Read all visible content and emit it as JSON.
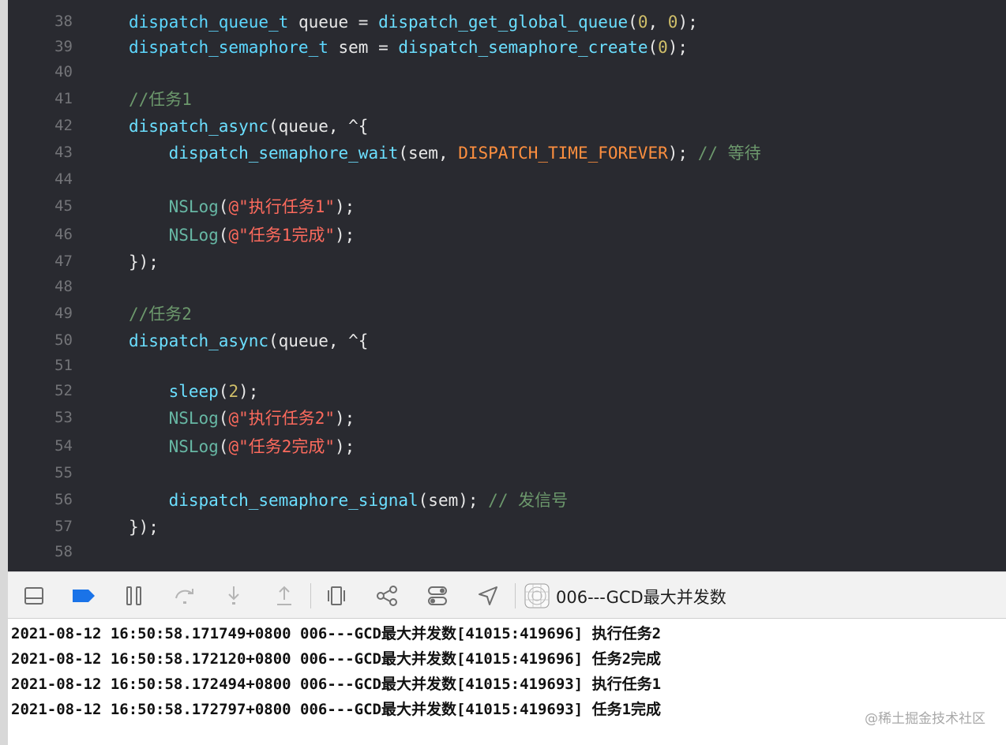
{
  "editor": {
    "lines": [
      {
        "n": "38",
        "tokens": [
          [
            "tok-type",
            "dispatch_queue_t"
          ],
          [
            "tok-plain",
            " queue = "
          ],
          [
            "tok-fn",
            "dispatch_get_global_queue"
          ],
          [
            "tok-plain",
            "("
          ],
          [
            "tok-num",
            "0"
          ],
          [
            "tok-plain",
            ", "
          ],
          [
            "tok-num",
            "0"
          ],
          [
            "tok-plain",
            ");"
          ]
        ]
      },
      {
        "n": "39",
        "tokens": [
          [
            "tok-type",
            "dispatch_semaphore_t"
          ],
          [
            "tok-plain",
            " sem = "
          ],
          [
            "tok-fn",
            "dispatch_semaphore_create"
          ],
          [
            "tok-plain",
            "("
          ],
          [
            "tok-num",
            "0"
          ],
          [
            "tok-plain",
            ");"
          ]
        ]
      },
      {
        "n": "40",
        "tokens": []
      },
      {
        "n": "41",
        "tokens": [
          [
            "tok-com",
            "//任务1"
          ]
        ]
      },
      {
        "n": "42",
        "tokens": [
          [
            "tok-fn",
            "dispatch_async"
          ],
          [
            "tok-plain",
            "(queue, ^{"
          ]
        ]
      },
      {
        "n": "43",
        "tokens": [
          [
            "tok-plain",
            "    "
          ],
          [
            "tok-fn",
            "dispatch_semaphore_wait"
          ],
          [
            "tok-plain",
            "(sem, "
          ],
          [
            "tok-macro",
            "DISPATCH_TIME_FOREVER"
          ],
          [
            "tok-plain",
            "); "
          ],
          [
            "tok-com",
            "// 等待"
          ]
        ]
      },
      {
        "n": "44",
        "tokens": []
      },
      {
        "n": "45",
        "tokens": [
          [
            "tok-plain",
            "    "
          ],
          [
            "tok-nslog",
            "NSLog"
          ],
          [
            "tok-plain",
            "("
          ],
          [
            "tok-str",
            "@\"执行任务1\""
          ],
          [
            "tok-plain",
            ");"
          ]
        ]
      },
      {
        "n": "46",
        "tokens": [
          [
            "tok-plain",
            "    "
          ],
          [
            "tok-nslog",
            "NSLog"
          ],
          [
            "tok-plain",
            "("
          ],
          [
            "tok-str",
            "@\"任务1完成\""
          ],
          [
            "tok-plain",
            ");"
          ]
        ]
      },
      {
        "n": "47",
        "tokens": [
          [
            "tok-plain",
            "});"
          ]
        ]
      },
      {
        "n": "48",
        "tokens": []
      },
      {
        "n": "49",
        "tokens": [
          [
            "tok-com",
            "//任务2"
          ]
        ]
      },
      {
        "n": "50",
        "tokens": [
          [
            "tok-fn",
            "dispatch_async"
          ],
          [
            "tok-plain",
            "(queue, ^{"
          ]
        ]
      },
      {
        "n": "51",
        "tokens": []
      },
      {
        "n": "52",
        "tokens": [
          [
            "tok-plain",
            "    "
          ],
          [
            "tok-fn",
            "sleep"
          ],
          [
            "tok-plain",
            "("
          ],
          [
            "tok-num",
            "2"
          ],
          [
            "tok-plain",
            ");"
          ]
        ]
      },
      {
        "n": "53",
        "tokens": [
          [
            "tok-plain",
            "    "
          ],
          [
            "tok-nslog",
            "NSLog"
          ],
          [
            "tok-plain",
            "("
          ],
          [
            "tok-str",
            "@\"执行任务2\""
          ],
          [
            "tok-plain",
            ");"
          ]
        ]
      },
      {
        "n": "54",
        "tokens": [
          [
            "tok-plain",
            "    "
          ],
          [
            "tok-nslog",
            "NSLog"
          ],
          [
            "tok-plain",
            "("
          ],
          [
            "tok-str",
            "@\"任务2完成\""
          ],
          [
            "tok-plain",
            ");"
          ]
        ]
      },
      {
        "n": "55",
        "tokens": []
      },
      {
        "n": "56",
        "tokens": [
          [
            "tok-plain",
            "    "
          ],
          [
            "tok-fn",
            "dispatch_semaphore_signal"
          ],
          [
            "tok-plain",
            "(sem); "
          ],
          [
            "tok-com",
            "// 发信号"
          ]
        ]
      },
      {
        "n": "57",
        "tokens": [
          [
            "tok-plain",
            "});"
          ]
        ]
      },
      {
        "n": "58",
        "tokens": []
      }
    ]
  },
  "debug_bar": {
    "buttons": [
      {
        "name": "hide-debug-area-button",
        "icon": "panel-icon"
      },
      {
        "name": "breakpoints-toggle-button",
        "icon": "breakpoint-icon"
      },
      {
        "name": "pause-button",
        "icon": "pause-icon"
      },
      {
        "name": "step-over-button",
        "icon": "step-over-icon"
      },
      {
        "name": "step-into-button",
        "icon": "step-into-icon"
      },
      {
        "name": "step-out-button",
        "icon": "step-out-icon"
      },
      {
        "name": "debug-view-hierarchy-button",
        "icon": "view-hierarchy-icon"
      },
      {
        "name": "memory-graph-button",
        "icon": "memory-graph-icon"
      },
      {
        "name": "environment-overrides-button",
        "icon": "toggles-icon"
      },
      {
        "name": "simulate-location-button",
        "icon": "location-arrow-icon"
      }
    ],
    "target_name": "006---GCD最大并发数",
    "colors": {
      "breakpoint_accent": "#1a73e8",
      "icon_gray": "#6e6e6e",
      "icon_disabled": "#b5b5b5"
    }
  },
  "console": {
    "lines": [
      "2021-08-12 16:50:58.171749+0800 006---GCD最大并发数[41015:419696] 执行任务2",
      "2021-08-12 16:50:58.172120+0800 006---GCD最大并发数[41015:419696] 任务2完成",
      "2021-08-12 16:50:58.172494+0800 006---GCD最大并发数[41015:419693] 执行任务1",
      "2021-08-12 16:50:58.172797+0800 006---GCD最大并发数[41015:419693] 任务1完成"
    ]
  },
  "watermark": "@稀土掘金技术社区"
}
